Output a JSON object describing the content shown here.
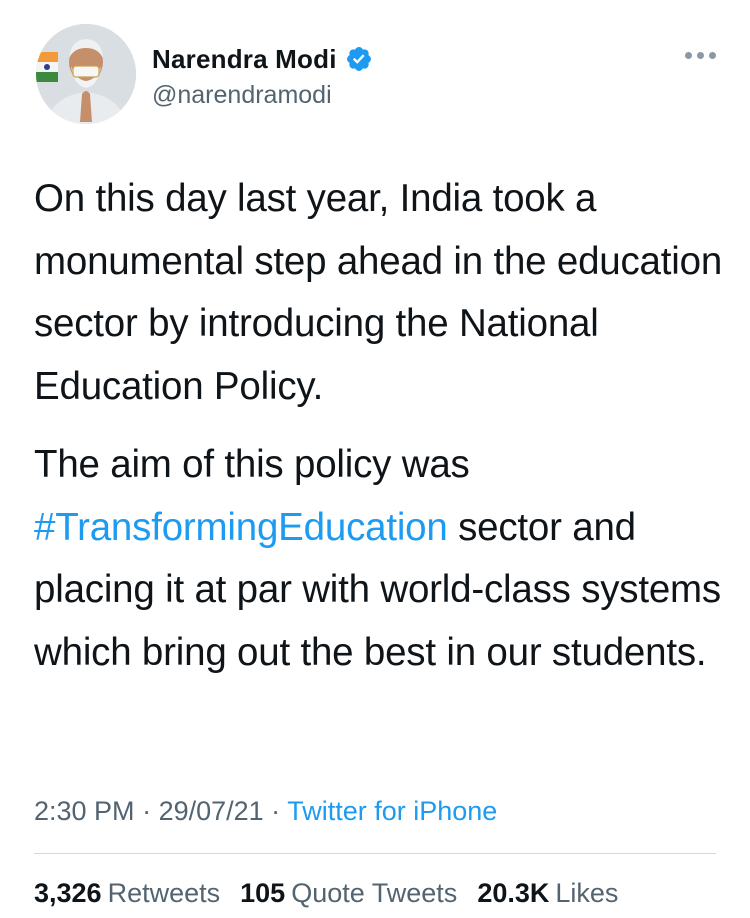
{
  "author": {
    "display_name": "Narendra Modi",
    "handle": "@narendramodi",
    "verified": true
  },
  "tweet": {
    "paragraph1": "On this day last year, India took a monumental step ahead in the education sector by introducing the National Education Policy.",
    "paragraph2_prefix": "The aim of this policy was ",
    "hashtag": "#TransformingEducation",
    "paragraph2_suffix": " sector and placing it at par with world-class systems which bring out the best in our students."
  },
  "meta": {
    "time": "2:30 PM",
    "separator": " · ",
    "date": "29/07/21",
    "source": "Twitter for iPhone"
  },
  "stats": {
    "retweets_count": "3,326",
    "retweets_label": "Retweets",
    "quotes_count": "105",
    "quotes_label": "Quote Tweets",
    "likes_count": "20.3K",
    "likes_label": "Likes"
  },
  "colors": {
    "link": "#1d9bf0",
    "secondary_text": "#536471",
    "primary_text": "#0f1419"
  },
  "icons": {
    "verified": "verified-badge-icon",
    "more": "more-options-icon"
  }
}
